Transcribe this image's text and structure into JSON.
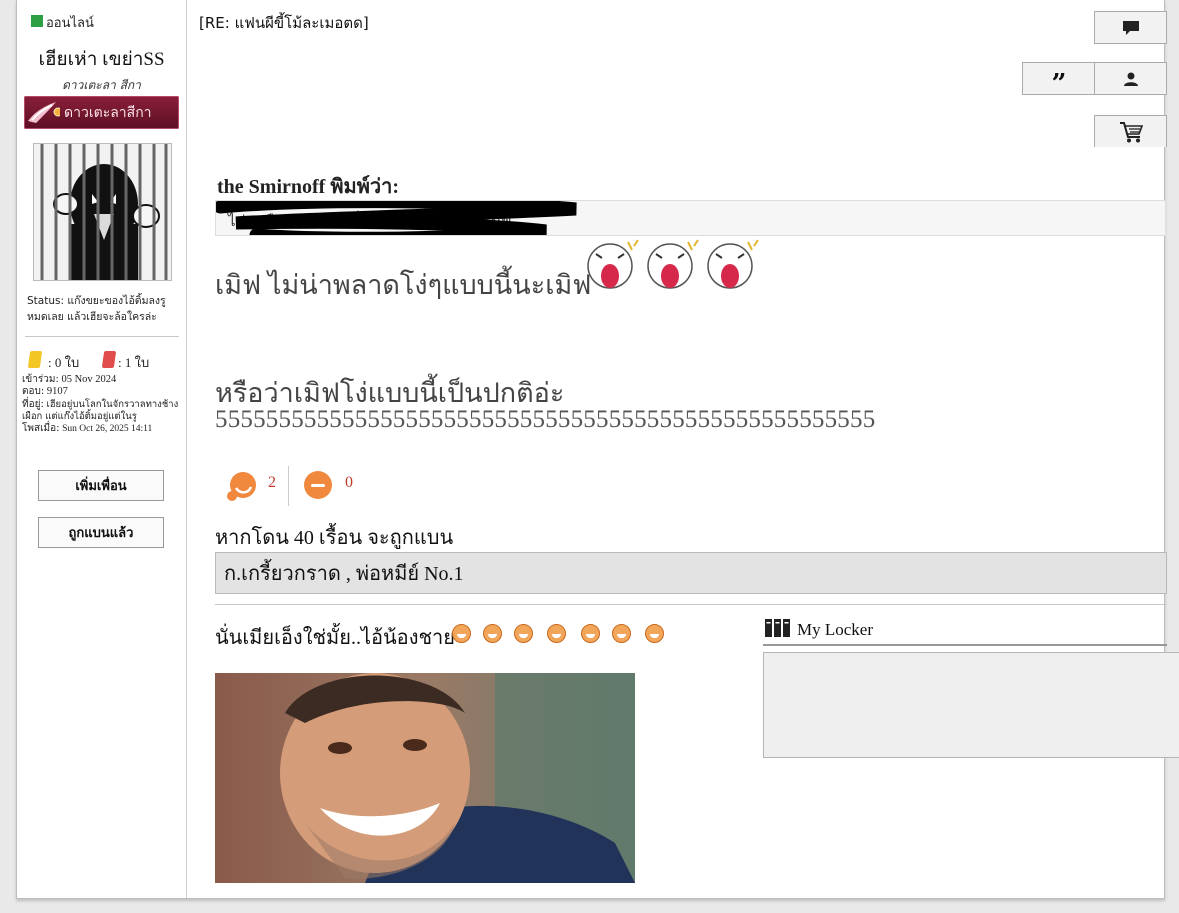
{
  "user": {
    "online_label": "ออนไลน์",
    "name": "เฮียเห่า เขย่าSS",
    "title": "ดาวเตะลา สีกา",
    "rank_badge": "ดาวเตะลาสีกา",
    "status": "Status: แก๊งขยะของไอ้ติ้มลงรูหมดเลย แล้วเฮียจะล้อใครล่ะ",
    "yellow_cards": ": 0 ใบ",
    "red_cards": ": 1 ใบ",
    "joined_label": "เข้าร่วม:",
    "joined_value": "05 Nov 2024",
    "posts_label": "ตอบ:",
    "posts_value": "9107",
    "location_label": "ที่อยู่:",
    "location_value": "เฮียอยู่บนโลกในจักรวาลทางช้างเผือก แต่แก๊งไอ้ติ้มอยู่แต่ในรู",
    "posted_label": "โพสเมื่อ:",
    "posted_value": "Sun Oct 26, 2025 14:11",
    "add_friend_label": "เพิ่มเพื่อน",
    "banned_label": "ถูกแบนแล้ว"
  },
  "post": {
    "subject": "[RE: แฟนผีขี้โม้ละเมอตด]",
    "quote_author": "the Smirnoff พิมพ์ว่า:",
    "quote_text": "ไม่ เหมือนเดิมเลย เพิ่มฟ ก็ ได้ไม่ ตอบ มาเมิฟ",
    "line1": "เมิฟ ไม่น่าพลาดโง่ๆแบบนี้นะเมิฟ",
    "line2": "หรือว่าเมิฟโง่แบบนี้เป็นปกติอ่ะ",
    "line3": "5555555555555555555555555555555555555555555555555555",
    "reaction_like_count": "2",
    "reaction_dislike_count": "0",
    "warning": "หากโดน 40 เรื้อน จะถูกแบน",
    "pill_text": "ก.เกรี้ยวกราด , พ่อหมีย์ No.1",
    "signature_text": "นั่นเมียเอ็งใช่มั้ย..ไอ้น้องชาย",
    "locker_title": "My Locker"
  },
  "colors": {
    "online": "#2ea043",
    "rank_banner": "#7a1a34",
    "reaction_count": "#c0392b",
    "pill_bg": "#e3e3e3"
  },
  "icons": {
    "comment": "comment-icon",
    "quote": "quote-icon",
    "profile": "user-icon",
    "cart": "cart-icon",
    "locker": "locker-icon"
  }
}
